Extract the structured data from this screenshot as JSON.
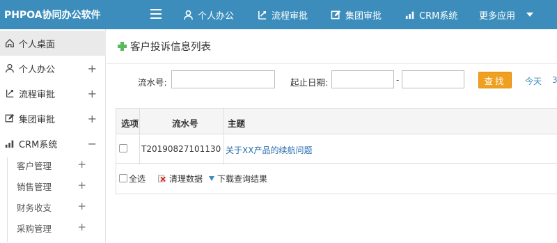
{
  "app": {
    "title": "PHPOA协同办公软件"
  },
  "topnav": [
    {
      "label": "个人办公",
      "icon": "user-icon"
    },
    {
      "label": "流程审批",
      "icon": "flow-icon"
    },
    {
      "label": "集团审批",
      "icon": "edit-icon"
    },
    {
      "label": "CRM系统",
      "icon": "bar-chart-icon"
    },
    {
      "label": "更多应用",
      "icon": "caret-down-icon"
    }
  ],
  "sidebar": {
    "items": [
      {
        "label": "个人桌面",
        "icon": "home-icon",
        "toggle": ""
      },
      {
        "label": "个人办公",
        "icon": "user-icon",
        "toggle": "+"
      },
      {
        "label": "流程审批",
        "icon": "flow-icon",
        "toggle": "+"
      },
      {
        "label": "集团审批",
        "icon": "edit-icon",
        "toggle": "+"
      },
      {
        "label": "CRM系统",
        "icon": "bar-chart-icon",
        "toggle": "−"
      }
    ],
    "subitems": [
      {
        "label": "客户管理",
        "toggle": "+"
      },
      {
        "label": "销售管理",
        "toggle": "+"
      },
      {
        "label": "财务收支",
        "toggle": "+"
      },
      {
        "label": "采购管理",
        "toggle": "+"
      }
    ]
  },
  "page": {
    "title": "客户投诉信息列表"
  },
  "search": {
    "serial_label": "流水号:",
    "serial_value": "",
    "date_label": "起止日期:",
    "date_start": "",
    "date_sep": "-",
    "date_end": "",
    "button": "查找",
    "today": "今天",
    "more": "3"
  },
  "table": {
    "headers": [
      "选项",
      "流水号",
      "主题"
    ],
    "rows": [
      {
        "serial": "T20190827101130",
        "subject": "关于XX产品的续航问题"
      }
    ]
  },
  "footer": {
    "select_all": "全选",
    "clear_data": "清理数据",
    "download": "下载查询结果"
  },
  "colors": {
    "topbar": "#3c8dbc",
    "accent": "#f0a020",
    "link": "#2a6fb0"
  }
}
